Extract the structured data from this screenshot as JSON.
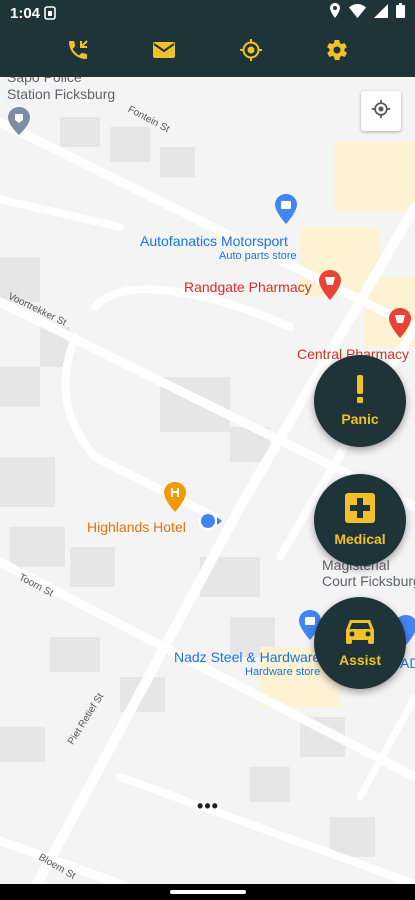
{
  "status_bar": {
    "time": "1:04",
    "icons": [
      "sim-card-icon",
      "location-icon",
      "wifi-icon",
      "signal-icon",
      "battery-icon"
    ]
  },
  "toolbar": {
    "icons": [
      "phone-icon",
      "mail-icon",
      "crosshair-icon",
      "gear-icon"
    ]
  },
  "map": {
    "pois": [
      {
        "name": "Sapo Police\nStation Ficksburg",
        "category": "police"
      },
      {
        "name": "Autofanatics Motorsport",
        "subtitle": "Auto parts store",
        "category": "shopping"
      },
      {
        "name": "Randgate Pharmacy",
        "category": "pharmacy"
      },
      {
        "name": "Central Pharmacy",
        "category": "pharmacy"
      },
      {
        "name": "Highlands Hotel",
        "category": "hotel"
      },
      {
        "name": "Magisterial\nCourt Ficksburg",
        "category": "government"
      },
      {
        "name": "Nadz Steel & Hardware",
        "subtitle": "Hardware store",
        "category": "shopping"
      },
      {
        "name": "ADI",
        "category": "shopping"
      }
    ],
    "streets": [
      "Fontein St",
      "Voortrekker St",
      "Toorn St",
      "Piet Retief St",
      "Bloem St"
    ]
  },
  "fabs": {
    "panic": "Panic",
    "medical": "Medical",
    "assist": "Assist"
  },
  "more_label": "•••",
  "colors": {
    "bar_bg": "#1f3438",
    "accent": "#f0c12b",
    "blue_poi": "#1a73e8",
    "pharmacy": "#e53935",
    "hotel": "#e8710a"
  }
}
